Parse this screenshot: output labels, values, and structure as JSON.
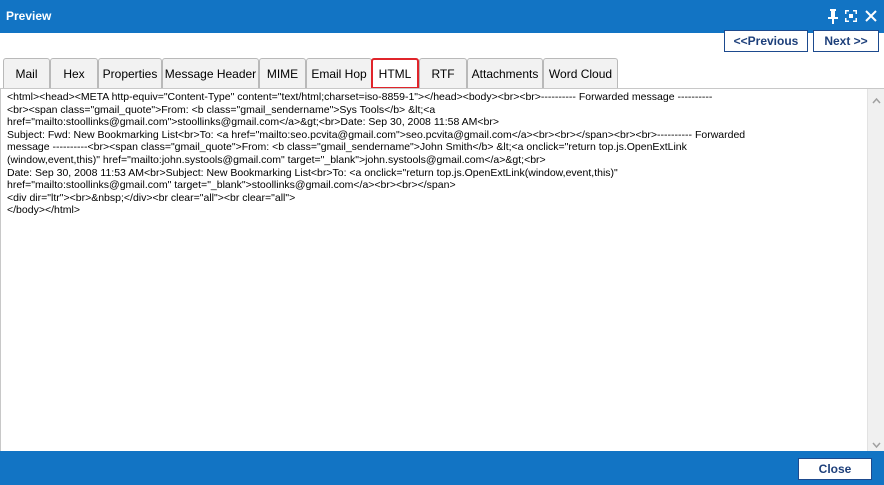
{
  "window": {
    "title": "Preview",
    "icons": [
      "pin-icon",
      "maximize-icon",
      "close-icon"
    ],
    "accent_color": "#1274c4"
  },
  "nav": {
    "previous_label": "<<Previous",
    "next_label": "Next >>"
  },
  "tabs": [
    {
      "label": "Mail",
      "active": false
    },
    {
      "label": "Hex",
      "active": false
    },
    {
      "label": "Properties",
      "active": false
    },
    {
      "label": "Message Header",
      "active": false
    },
    {
      "label": "MIME",
      "active": false
    },
    {
      "label": "Email Hop",
      "active": false
    },
    {
      "label": "HTML",
      "active": true
    },
    {
      "label": "RTF",
      "active": false
    },
    {
      "label": "Attachments",
      "active": false
    },
    {
      "label": "Word Cloud",
      "active": false
    }
  ],
  "html_source": {
    "lines": [
      "<html><head><META http-equiv=\"Content-Type\" content=\"text/html;charset=iso-8859-1\"></head><body><br><br>---------- Forwarded message ----------",
      "<br><span class=\"gmail_quote\">From: <b class=\"gmail_sendername\">Sys Tools</b> &lt;<a",
      "href=\"mailto:stoollinks@gmail.com\">stoollinks@gmail.com</a>&gt;<br>Date: Sep 30, 2008 11:58 AM<br>",
      "Subject: Fwd: New Bookmarking List<br>To: <a href=\"mailto:seo.pcvita@gmail.com\">seo.pcvita@gmail.com</a><br><br></span><br><br>---------- Forwarded",
      "message ----------<br><span class=\"gmail_quote\">From: <b class=\"gmail_sendername\">John Smith</b> &lt;<a onclick=\"return top.js.OpenExtLink",
      "(window,event,this)\" href=\"mailto:john.systools@gmail.com\" target=\"_blank\">john.systools@gmail.com</a>&gt;<br>",
      "Date: Sep 30, 2008 11:53 AM<br>Subject: New Bookmarking List<br>To: <a onclick=\"return top.js.OpenExtLink(window,event,this)\"",
      "href=\"mailto:stoollinks@gmail.com\" target=\"_blank\">stoollinks@gmail.com</a><br><br></span>",
      "<div dir=\"ltr\"><br>&nbsp;</div><br clear=\"all\"><br clear=\"all\">",
      "</body></html>"
    ]
  },
  "footer": {
    "close_label": "Close"
  }
}
